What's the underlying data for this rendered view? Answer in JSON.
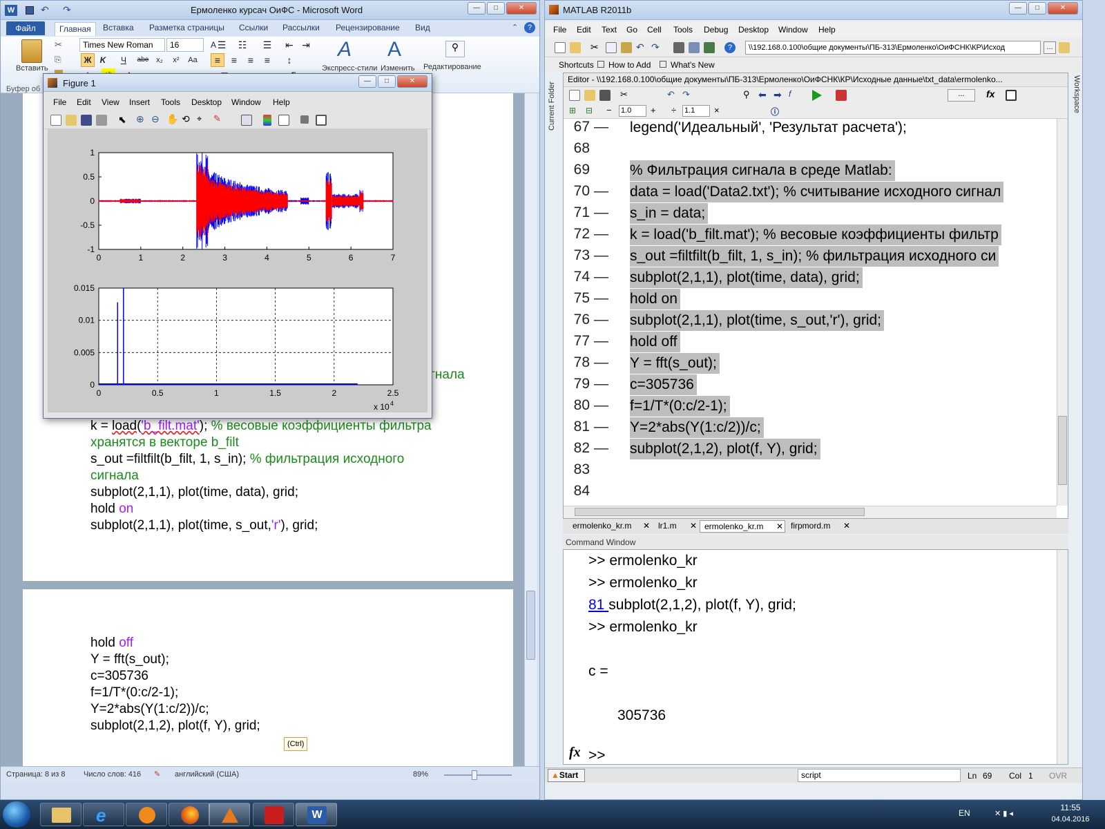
{
  "word": {
    "title": "Ермоленко курсач ОиФС  -  Microsoft Word",
    "tabs": [
      "Файл",
      "Главная",
      "Вставка",
      "Разметка страницы",
      "Ссылки",
      "Рассылки",
      "Рецензирование",
      "Вид"
    ],
    "font_name": "Times New Roman",
    "font_size": "16",
    "paste_label": "Вставить",
    "clipboard_group": "Буфер об",
    "styles_label": "Экспресс-стили",
    "change_label": "Изменить",
    "edit_label": "Редактирование",
    "page1_partial": "гнала",
    "page1_lines": {
      "l1a": "k = ",
      "l1b": "load",
      "l1c": "(",
      "l1d": "'b_filt.mat'",
      "l1e": "); ",
      "l1f": "% весовые коэффициенты фильтра",
      "l2": "хранятся в векторе b_filt",
      "l3a": "s_out =",
      "l3b": "filtfilt(b_filt, 1, s_in);",
      "l3c": " % фильтрация исходного",
      "l4": "сигнала",
      "l5": "subplot(2,1,1), plot(time, data), grid;",
      "l6a": "hold ",
      "l6b": "on",
      "l7a": "subplot(2,1,1), plot(time, s_out,",
      "l7b": "'r'",
      "l7c": "), grid;"
    },
    "page2_lines": {
      "l1a": "hold ",
      "l1b": "off",
      "l2": "Y = fft(s_out);",
      "l3": "c=305736",
      "l4": "f=1/T*(0:c/2-1);",
      "l5": "Y=2*abs(Y(1:c/2))/c;",
      "l6": "subplot(2,1,2), plot(f, Y), grid;"
    },
    "paste_options": "(Ctrl)",
    "status": {
      "page": "Страница: 8 из 8",
      "words": "Число слов: 416",
      "lang": "английский (США)",
      "zoom": "89%"
    }
  },
  "figure": {
    "title": "Figure 1",
    "menu": [
      "File",
      "Edit",
      "View",
      "Insert",
      "Tools",
      "Desktop",
      "Window",
      "Help"
    ]
  },
  "chart_data": [
    {
      "type": "line",
      "series": [
        {
          "color": "#0000ff"
        },
        {
          "color": "#ff0000"
        }
      ],
      "x_ticks": [
        "0",
        "1",
        "2",
        "3",
        "4",
        "5",
        "6",
        "7"
      ],
      "y_ticks": [
        "-1",
        "-0.5",
        "0",
        "0.5",
        "1"
      ],
      "xlim": [
        0,
        7
      ],
      "ylim": [
        -1,
        1
      ],
      "grid": false
    },
    {
      "type": "line",
      "series": [
        {
          "color": "#0000ff"
        }
      ],
      "x_ticks": [
        "0",
        "0.5",
        "1",
        "1.5",
        "2",
        "2.5"
      ],
      "y_ticks": [
        "0",
        "0.005",
        "0.01",
        "0.015"
      ],
      "xlim": [
        0,
        2.5
      ],
      "ylim": [
        0,
        0.015
      ],
      "x_multiplier": "x 10",
      "x_multiplier_exp": "4",
      "grid": true,
      "peaks": [
        {
          "x": 0.16,
          "y": 0.0128
        },
        {
          "x": 0.21,
          "y": 0.0152
        }
      ]
    }
  ],
  "matlab": {
    "title": "MATLAB  R2011b",
    "menu": [
      "File",
      "Edit",
      "Text",
      "Go",
      "Cell",
      "Tools",
      "Debug",
      "Desktop",
      "Window",
      "Help"
    ],
    "path": "\\\\192.168.0.100\\общие документы\\ПБ-313\\Ермоленко\\ОиФСНК\\КР\\Исход",
    "shortcuts": [
      "Shortcuts",
      "How to Add",
      "What's New"
    ],
    "current_folder": "Current Folder",
    "workspace": "Workspace",
    "editor_title": "Editor - \\\\192.168.0.100\\общие документы\\ПБ-313\\Ермоленко\\ОиФСНК\\КР\\Исходные данные\\txt_data\\ermolenko...",
    "cell_value1": "1.0",
    "cell_value2": "1.1",
    "code_lines": [
      {
        "n": "67",
        "t": "legend('Идеальный', 'Результат расчета');",
        "hl": false,
        "dash": true
      },
      {
        "n": "68",
        "t": "",
        "hl": false,
        "dash": false
      },
      {
        "n": "69",
        "t": "% Фильтрация сигнала в среде Matlab:",
        "hl": true,
        "dash": false
      },
      {
        "n": "70",
        "t": "data = load('Data2.txt'); % считывание исходного сигнал",
        "hl": true,
        "dash": true
      },
      {
        "n": "71",
        "t": "s_in = data;",
        "hl": true,
        "dash": true
      },
      {
        "n": "72",
        "t": "k = load('b_filt.mat'); % весовые коэффициенты фильтр",
        "hl": true,
        "dash": true
      },
      {
        "n": "73",
        "t": "s_out =filtfilt(b_filt, 1, s_in); % фильтрация исходного си",
        "hl": true,
        "dash": true
      },
      {
        "n": "74",
        "t": "subplot(2,1,1), plot(time, data), grid;",
        "hl": true,
        "dash": true
      },
      {
        "n": "75",
        "t": "hold on",
        "hl": true,
        "dash": true
      },
      {
        "n": "76",
        "t": "subplot(2,1,1), plot(time, s_out,'r'), grid;",
        "hl": true,
        "dash": true
      },
      {
        "n": "77",
        "t": "hold off",
        "hl": true,
        "dash": true
      },
      {
        "n": "78",
        "t": "Y = fft(s_out);",
        "hl": true,
        "dash": true
      },
      {
        "n": "79",
        "t": "c=305736",
        "hl": true,
        "dash": true
      },
      {
        "n": "80",
        "t": "f=1/T*(0:c/2-1);",
        "hl": true,
        "dash": true
      },
      {
        "n": "81",
        "t": "Y=2*abs(Y(1:c/2))/c;",
        "hl": true,
        "dash": true
      },
      {
        "n": "82",
        "t": "subplot(2,1,2), plot(f, Y), grid;",
        "hl": true,
        "dash": true
      },
      {
        "n": "83",
        "t": "",
        "hl": false,
        "dash": false
      },
      {
        "n": "84",
        "t": "",
        "hl": false,
        "dash": false
      }
    ],
    "file_tabs": [
      "ermolenko_kr.m",
      "lr1.m",
      "ermolenko_kr.m",
      "firpmord.m"
    ],
    "command_window_title": "Command Window",
    "cmd_lines": [
      ">> ermolenko_kr",
      ">> ermolenko_kr"
    ],
    "cmd_link": "81 ",
    "cmd_link_text": "subplot(2,1,2), plot(f, Y), grid;",
    "cmd_line4": ">> ermolenko_kr",
    "cmd_c": "c =",
    "cmd_val": "305736",
    "cmd_prompt": ">>",
    "start": "Start",
    "status_script": "script",
    "ln_label": "Ln",
    "ln": "69",
    "col_label": "Col",
    "col": "1",
    "ovr": "OVR"
  },
  "taskbar": {
    "lang": "EN",
    "time": "11:55",
    "date": "04.04.2016"
  }
}
